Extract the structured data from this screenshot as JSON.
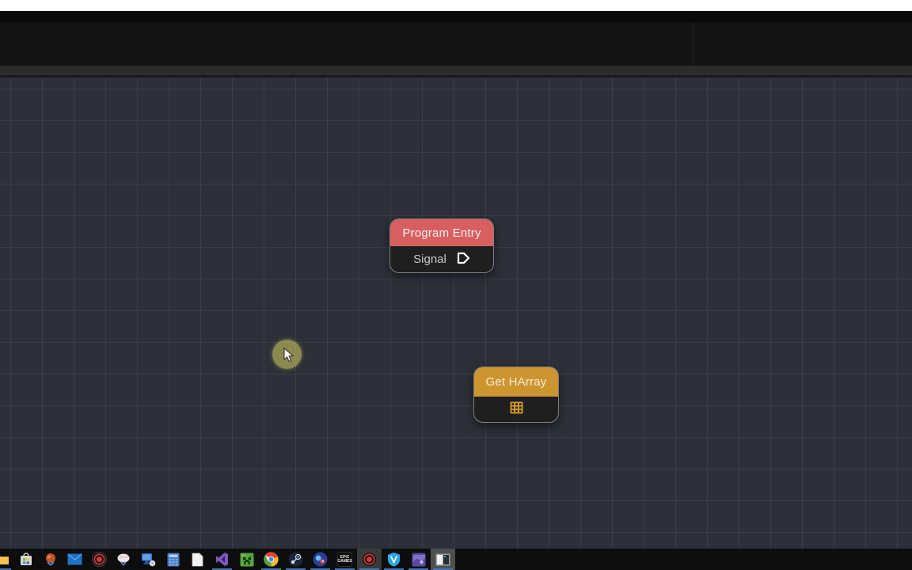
{
  "editor": {
    "description": "visual scripting node graph",
    "canvas": {
      "background": "#2d3039",
      "grid_line_color": "#3a3e48",
      "grid_size_px": 40
    }
  },
  "nodes": {
    "program_entry": {
      "title": "Program Entry",
      "header_color": "#d85f5f",
      "body_color": "#1f1f1f",
      "pin_label": "Signal",
      "pin_icon": "exec-arrow-icon"
    },
    "get_harray": {
      "title": "Get HArray",
      "header_color": "#cc9530",
      "body_color": "#1f1f1f",
      "body_icon": "array-grid-icon",
      "icon_color": "#cf9a30"
    }
  },
  "cursor": {
    "halo_color": "#d0ca5c",
    "icon": "mouse-pointer-icon"
  },
  "taskbar": {
    "background": "#0d0d0d",
    "running_underline_color": "#4179b5",
    "items": [
      {
        "icon": "file-explorer-icon",
        "running": true,
        "active": false
      },
      {
        "icon": "microsoft-store-icon",
        "running": false,
        "active": false
      },
      {
        "icon": "paint3d-ball-icon",
        "running": false,
        "active": false
      },
      {
        "icon": "mail-icon",
        "running": false,
        "active": false
      },
      {
        "icon": "record-button-icon",
        "running": false,
        "active": false
      },
      {
        "icon": "snip-brain-icon",
        "running": false,
        "active": false
      },
      {
        "icon": "this-pc-icon",
        "running": false,
        "active": false
      },
      {
        "icon": "calculator-icon",
        "running": false,
        "active": false
      },
      {
        "icon": "notepad-icon",
        "running": false,
        "active": false
      },
      {
        "icon": "visual-studio-icon",
        "running": true,
        "active": false
      },
      {
        "icon": "minecraft-icon",
        "running": false,
        "active": false
      },
      {
        "icon": "chrome-icon",
        "running": true,
        "active": false
      },
      {
        "icon": "steam-icon",
        "running": true,
        "active": false
      },
      {
        "icon": "game-orb-icon",
        "running": true,
        "active": false
      },
      {
        "icon": "epic-games-icon",
        "running": true,
        "active": false,
        "label": "EPIC GAMES"
      },
      {
        "icon": "record-button-icon",
        "running": true,
        "active": true
      },
      {
        "icon": "vpn-shield-icon",
        "running": true,
        "active": false
      },
      {
        "icon": "wallpaper-app-icon",
        "running": true,
        "active": false
      },
      {
        "icon": "app-window-icon",
        "running": true,
        "active": true
      }
    ]
  }
}
